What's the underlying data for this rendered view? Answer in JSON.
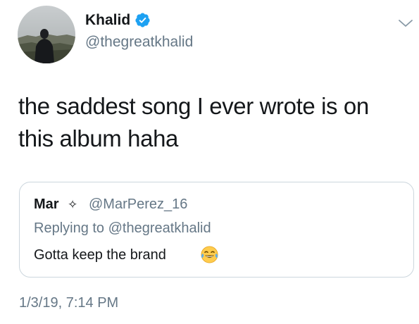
{
  "tweet": {
    "display_name": "Khalid",
    "handle": "@thegreatkhalid",
    "text": "the saddest song I ever wrote is on this album haha",
    "timestamp": "1/3/19, 7:14 PM",
    "verified_icon": "verified-badge-icon",
    "menu_icon": "chevron-down-icon"
  },
  "quoted_tweet": {
    "display_name": "Mar",
    "name_symbol": "✧",
    "handle": "@MarPerez_16",
    "replying_prefix": "Replying to ",
    "replying_handle": "@thegreatkhalid",
    "text": "Gotta keep the brand",
    "emoji_icon": "face-with-tears-of-joy-icon"
  },
  "colors": {
    "text_primary": "#14171a",
    "text_secondary": "#657786",
    "verified_blue": "#1da1f2",
    "border": "#ccd6dd"
  }
}
